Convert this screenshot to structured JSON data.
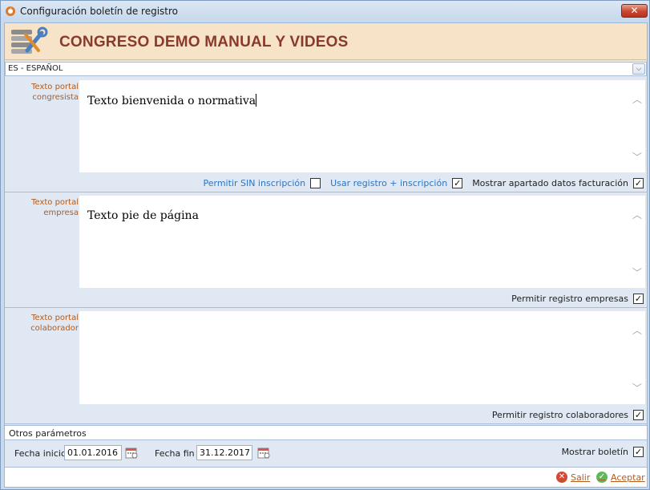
{
  "window": {
    "title": "Configuración boletín de registro",
    "close_label": "✕"
  },
  "header": {
    "title": "CONGRESO DEMO MANUAL Y VIDEOS",
    "icon": "tools-database-icon"
  },
  "language": {
    "selected": "ES - ESPAÑOL"
  },
  "sections": [
    {
      "label_line1": "Texto portal",
      "label_line2": "congresista",
      "content": "Texto bienvenida o normativa",
      "options": [
        {
          "label": "Permitir SIN inscripción",
          "checked": false,
          "style": "link"
        },
        {
          "label": "Usar registro + inscripción",
          "checked": true,
          "style": "link"
        },
        {
          "label": "Mostrar apartado datos facturación",
          "checked": true,
          "style": "plain"
        }
      ]
    },
    {
      "label_line1": "Texto portal",
      "label_line2": "empresa",
      "content": "Texto pie de página",
      "options": [
        {
          "label": "Permitir registro empresas",
          "checked": true,
          "style": "plain"
        }
      ]
    },
    {
      "label_line1": "Texto portal",
      "label_line2": "colaborador",
      "content": "",
      "options": [
        {
          "label": "Permitir registro colaboradores",
          "checked": true,
          "style": "plain"
        }
      ]
    }
  ],
  "otros": {
    "label": "Otros parámetros",
    "fecha_inicio_label": "Fecha inicio",
    "fecha_inicio": "01.01.2016",
    "fecha_fin_label": "Fecha fin",
    "fecha_fin": "31.12.2017",
    "mostrar_label": "Mostrar boletín",
    "mostrar_checked": true
  },
  "footer": {
    "salir": "Salir",
    "aceptar": "Aceptar"
  },
  "colors": {
    "header_bg": "#f7e4c8",
    "header_title": "#8a3a2c",
    "label_orange": "#b25c1f",
    "link_blue": "#2a76c5"
  }
}
